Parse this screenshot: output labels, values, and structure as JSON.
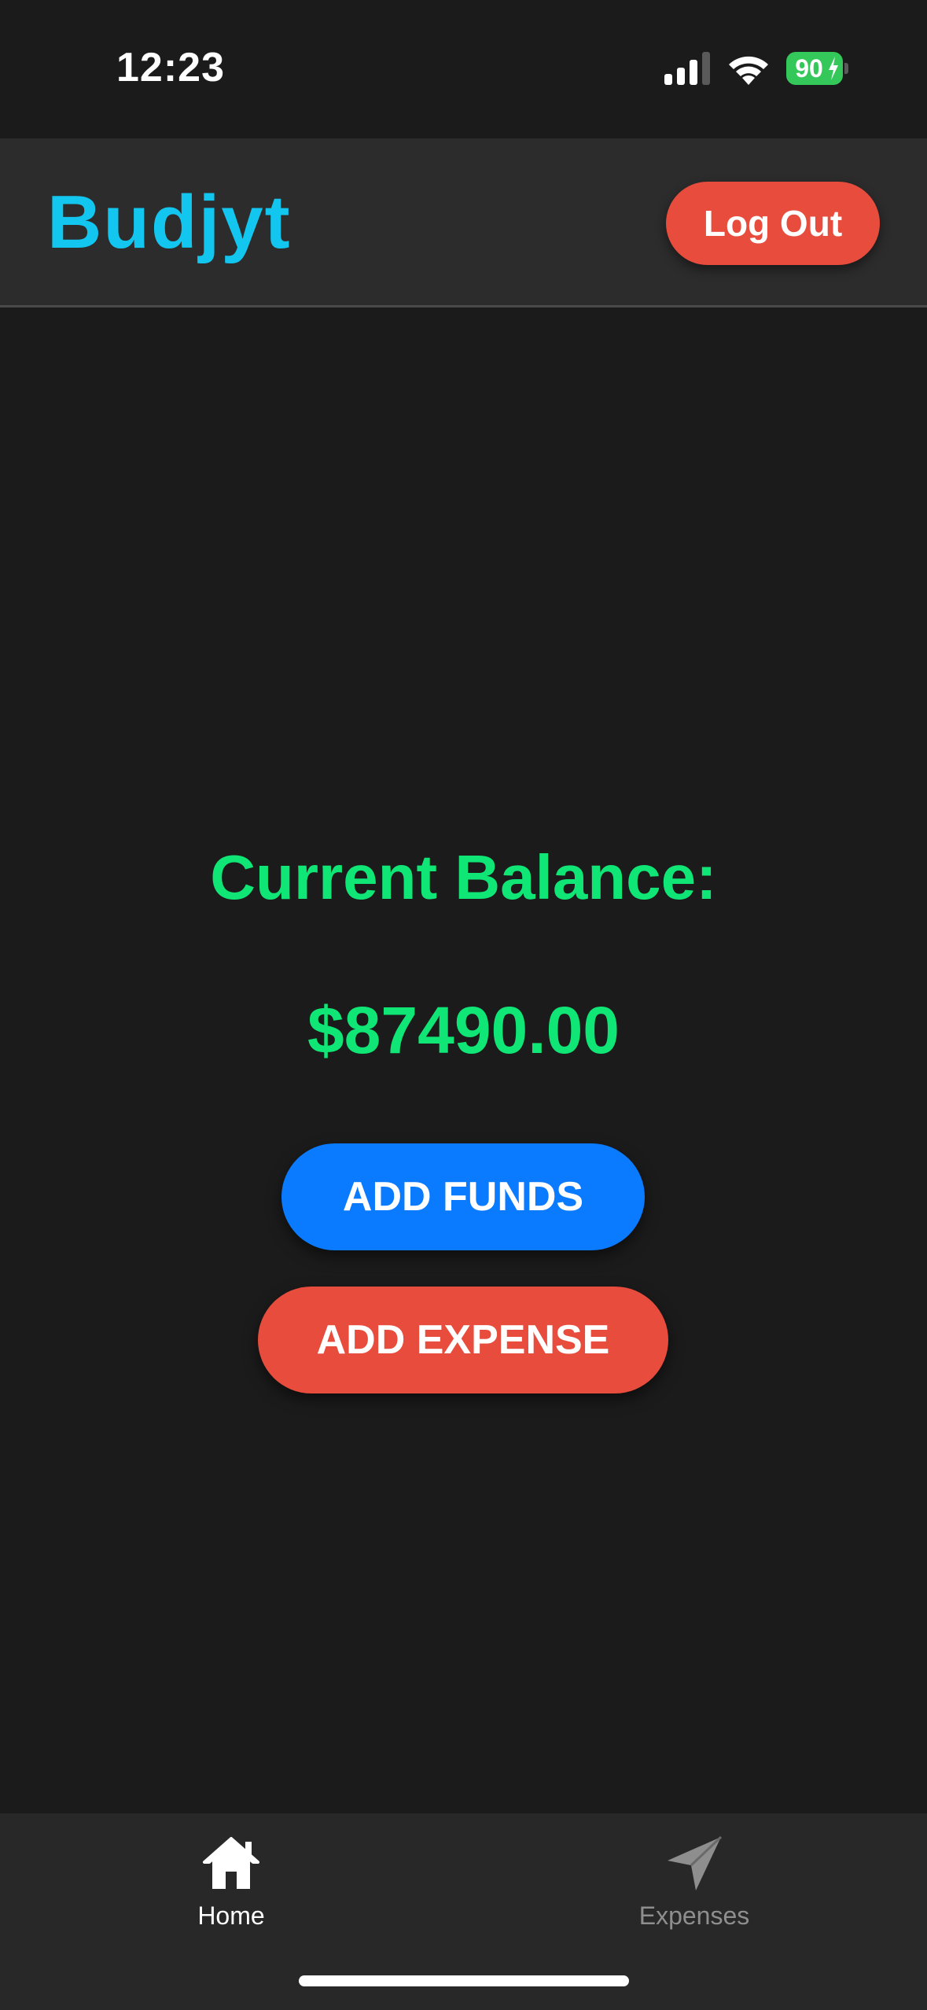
{
  "status_bar": {
    "time": "12:23",
    "battery_level": "90",
    "signal_icon": "cellular-signal-icon",
    "wifi_icon": "wifi-icon",
    "battery_icon": "battery-charging-icon"
  },
  "header": {
    "brand": "Budjyt",
    "logout_label": "Log Out"
  },
  "main": {
    "balance_label": "Current Balance:",
    "balance_amount": "$87490.00",
    "add_funds_label": "ADD FUNDS",
    "add_expense_label": "ADD EXPENSE"
  },
  "tab_bar": {
    "tabs": [
      {
        "label": "Home",
        "icon": "house-icon",
        "active": true
      },
      {
        "label": "Expenses",
        "icon": "paper-plane-icon",
        "active": false
      }
    ]
  },
  "colors": {
    "background": "#1b1b1b",
    "header": "#2c2c2c",
    "brand": "#12c6f0",
    "balance_green": "#0fe676",
    "danger_red": "#e84c3d",
    "primary_blue": "#0a7aff",
    "battery_green": "#34c759"
  }
}
